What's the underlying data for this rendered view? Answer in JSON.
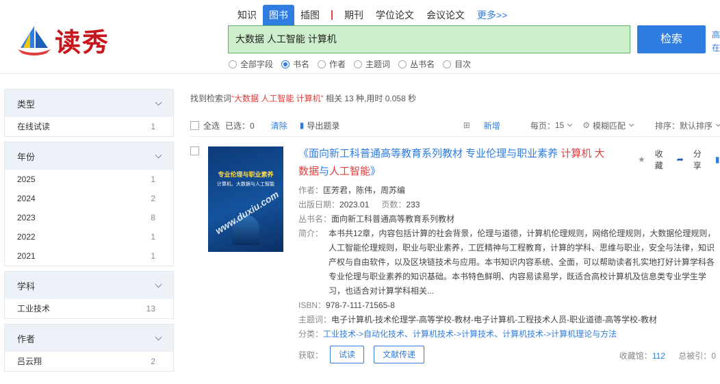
{
  "logo": {
    "text": "读秀"
  },
  "tabs": [
    {
      "label": "知识"
    },
    {
      "label": "图书",
      "active": true
    },
    {
      "label": "插图"
    },
    {
      "label": "期刊"
    },
    {
      "label": "学位论文"
    },
    {
      "label": "会议论文"
    },
    {
      "label": "更多>>"
    }
  ],
  "search": {
    "value": "大数据  人工智能 计算机",
    "button": "检索"
  },
  "side_links": [
    "高",
    "在"
  ],
  "search_fields": [
    {
      "label": "全部字段",
      "selected": false
    },
    {
      "label": "书名",
      "selected": true
    },
    {
      "label": "作者",
      "selected": false
    },
    {
      "label": "主题词",
      "selected": false
    },
    {
      "label": "丛书名",
      "selected": false
    },
    {
      "label": "目次",
      "selected": false
    }
  ],
  "facets": [
    {
      "title": "类型",
      "items": [
        {
          "label": "在线试读",
          "count": "1"
        }
      ]
    },
    {
      "title": "年份",
      "items": [
        {
          "label": "2025",
          "count": "1"
        },
        {
          "label": "2024",
          "count": "2"
        },
        {
          "label": "2023",
          "count": "8"
        },
        {
          "label": "2022",
          "count": "1"
        },
        {
          "label": "2021",
          "count": "1"
        }
      ]
    },
    {
      "title": "学科",
      "items": [
        {
          "label": "工业技术",
          "count": "13"
        }
      ]
    },
    {
      "title": "作者",
      "items": [
        {
          "label": "吕云翔",
          "count": "2"
        }
      ]
    }
  ],
  "summary": {
    "prefix": "找到检索词",
    "keyword": "“大数据 人工智能 计算机”",
    "suffix": "相关 13 种,用时 0.058 秒"
  },
  "toolbar": {
    "select_all": "全选",
    "selected": "已选：0",
    "clear": "清除",
    "export": "导出题录",
    "new": "新增",
    "per_page_label": "每页：",
    "per_page": "15",
    "match": "模糊匹配",
    "sort_label": "排序：",
    "sort": "默认排序"
  },
  "result": {
    "cover_title": "专业伦理与职业素养",
    "cover_sub": "计算机、大数据与人工智能",
    "cover_watermark": "www.duxiu.com",
    "title_prefix": "《面向新工科普通高等教育系列教材 专业伦理与职业素养 ",
    "title_red1": "计算机",
    "title_red2": "大数据",
    "title_mid": "与",
    "title_red3": "人工智能",
    "title_suffix": "》",
    "actions": {
      "collect": "收藏",
      "share": "分享",
      "export": "导出"
    },
    "author_label": "作者：",
    "author": "匡芳君，陈伟，周苏编",
    "date_label": "出版日期：",
    "date": "2023.01",
    "pages_label": "页数：",
    "pages": "233",
    "series_label": "丛书名：",
    "series": "面向新工科普通高等教育系列教材",
    "abstract_label": "简介：",
    "abstract": "本书共12章，内容包括计算的社会背景，伦理与道德，计算机伦理规则，网络伦理规则，大数据伦理规则，人工智能伦理规则，职业与职业素养，工匠精神与工程教育，计算的学科、思维与职业，安全与法律，知识产权与自由软件，以及区块链技术与应用。本书知识内容系统、全面，可以帮助读者扎实地打好计算学科各专业伦理与职业素养的知识基础。本书特色鲜明、内容易读易学，既适合高校计算机及信息类专业学生学习，也适合对计算学科相关...",
    "isbn_label": "ISBN：",
    "isbn": "978-7-111-71565-8",
    "subject_label": "主题词：",
    "subject": "电子计算机-技术伦理学-高等学校-教材-电子计算机-工程技术人员-职业道德-高等学校-教材",
    "class_label": "分类：",
    "class_parts": [
      "工业技术",
      "->",
      "自动化技术、计算机技术",
      "->",
      "计算技术、计算机技术",
      "->",
      "计算机理论与方法"
    ],
    "get_label": "获取：",
    "btn_trial": "试读",
    "btn_deliver": "文献传递",
    "lib_label": "收藏馆：",
    "lib_count": "112",
    "cited_label": "总被引：",
    "cited_count": "0"
  }
}
